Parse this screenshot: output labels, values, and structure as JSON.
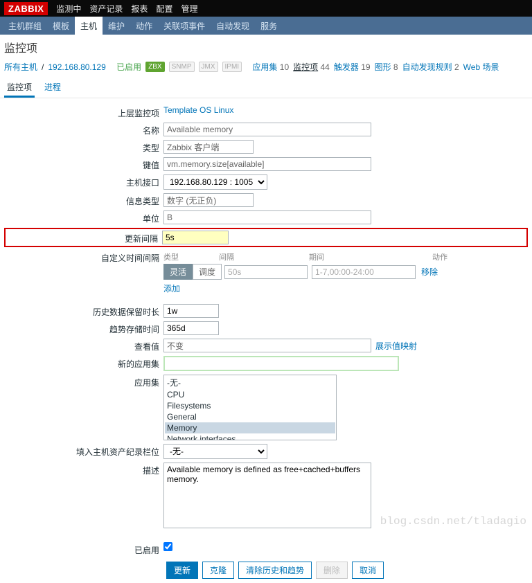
{
  "topMenu": [
    "监测中",
    "资产记录",
    "报表",
    "配置",
    "管理"
  ],
  "nav": [
    "主机群组",
    "模板",
    "主机",
    "维护",
    "动作",
    "关联项事件",
    "自动发现",
    "服务"
  ],
  "navActiveIndex": 2,
  "pageTitle": "监控项",
  "breadcrumb": {
    "allHosts": "所有主机",
    "host": "192.168.80.129",
    "enabled": "已启用",
    "badges": [
      "ZBX",
      "SNMP",
      "JMX",
      "IPMI"
    ],
    "links": [
      {
        "label": "应用集",
        "count": "10"
      },
      {
        "label": "监控项",
        "count": "44",
        "active": true
      },
      {
        "label": "触发器",
        "count": "19"
      },
      {
        "label": "图形",
        "count": "8"
      },
      {
        "label": "自动发现规则",
        "count": "2"
      },
      {
        "label": "Web 场景",
        "count": ""
      }
    ]
  },
  "tabs": [
    "监控项",
    "进程"
  ],
  "form": {
    "parentLabel": "上层监控项",
    "parentValue": "Template OS Linux",
    "nameLabel": "名称",
    "nameValue": "Available memory",
    "typeLabel": "类型",
    "typeValue": "Zabbix 客户端",
    "keyLabel": "键值",
    "keyValue": "vm.memory.size[available]",
    "ifaceLabel": "主机接口",
    "ifaceValue": "192.168.80.129 : 10050",
    "infoLabel": "信息类型",
    "infoValue": "数字 (无正负)",
    "unitLabel": "单位",
    "unitValue": "B",
    "intervalLabel": "更新间隔",
    "intervalValue": "5s",
    "customLabel": "自定义时间间隔",
    "customHeaders": {
      "c1": "类型",
      "c2": "间隔",
      "c3": "期间",
      "c4": "动作"
    },
    "toggle": {
      "on": "灵活",
      "off": "调度"
    },
    "customInterval": "50s",
    "customPeriod": "1-7,00:00-24:00",
    "remove": "移除",
    "add": "添加",
    "historyLabel": "历史数据保留时长",
    "historyValue": "1w",
    "trendLabel": "趋势存储时间",
    "trendValue": "365d",
    "showLabel": "查看值",
    "showValue": "不变",
    "showMapLink": "展示值映射",
    "newAppLabel": "新的应用集",
    "appsLabel": "应用集",
    "apps": [
      "-无-",
      "CPU",
      "Filesystems",
      "General",
      "Memory",
      "Network interfaces"
    ],
    "appsSelected": 4,
    "inventoryLabel": "填入主机资产纪录栏位",
    "inventoryValue": "-无-",
    "descLabel": "描述",
    "descValue": "Available memory is defined as free+cached+buffers memory.",
    "enabledLabel": "已启用"
  },
  "buttons": {
    "update": "更新",
    "clone": "克隆",
    "clear": "清除历史和趋势",
    "delete": "删除",
    "cancel": "取消"
  },
  "watermark": "blog.csdn.net/tladagio"
}
